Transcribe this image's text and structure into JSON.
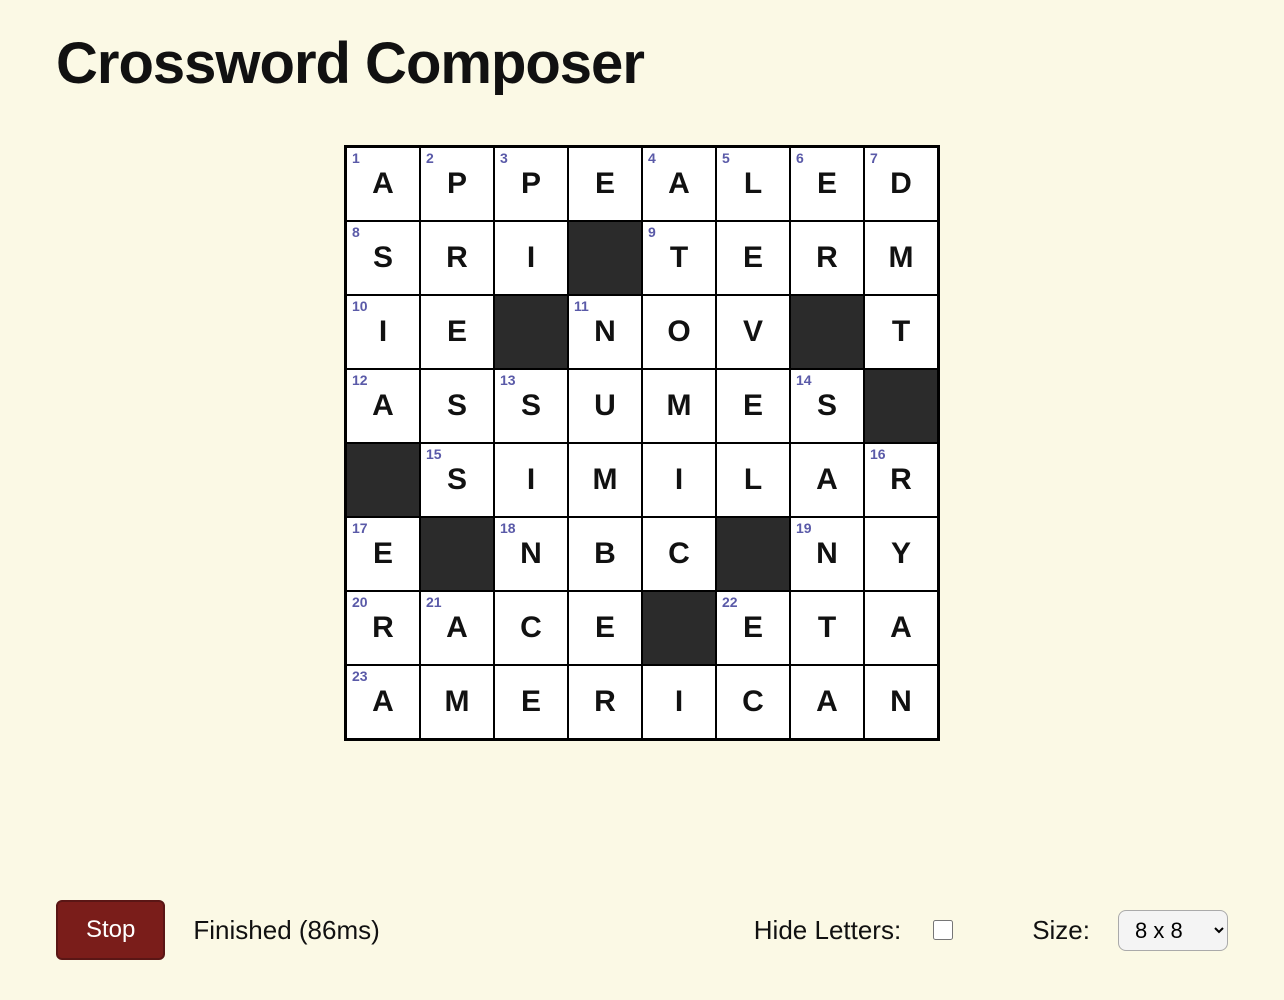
{
  "title": "Crossword Composer",
  "grid": {
    "size": 8,
    "rows": [
      [
        {
          "n": 1,
          "l": "A"
        },
        {
          "n": 2,
          "l": "P"
        },
        {
          "n": 3,
          "l": "P"
        },
        {
          "l": "E"
        },
        {
          "n": 4,
          "l": "A"
        },
        {
          "n": 5,
          "l": "L"
        },
        {
          "n": 6,
          "l": "E"
        },
        {
          "n": 7,
          "l": "D"
        }
      ],
      [
        {
          "n": 8,
          "l": "S"
        },
        {
          "l": "R"
        },
        {
          "l": "I"
        },
        {
          "black": true
        },
        {
          "n": 9,
          "l": "T"
        },
        {
          "l": "E"
        },
        {
          "l": "R"
        },
        {
          "l": "M"
        }
      ],
      [
        {
          "n": 10,
          "l": "I"
        },
        {
          "l": "E"
        },
        {
          "black": true
        },
        {
          "n": 11,
          "l": "N"
        },
        {
          "l": "O"
        },
        {
          "l": "V"
        },
        {
          "black": true
        },
        {
          "l": "T"
        }
      ],
      [
        {
          "n": 12,
          "l": "A"
        },
        {
          "l": "S"
        },
        {
          "n": 13,
          "l": "S"
        },
        {
          "l": "U"
        },
        {
          "l": "M"
        },
        {
          "l": "E"
        },
        {
          "n": 14,
          "l": "S"
        },
        {
          "black": true
        }
      ],
      [
        {
          "black": true
        },
        {
          "n": 15,
          "l": "S"
        },
        {
          "l": "I"
        },
        {
          "l": "M"
        },
        {
          "l": "I"
        },
        {
          "l": "L"
        },
        {
          "l": "A"
        },
        {
          "n": 16,
          "l": "R"
        }
      ],
      [
        {
          "n": 17,
          "l": "E"
        },
        {
          "black": true
        },
        {
          "n": 18,
          "l": "N"
        },
        {
          "l": "B"
        },
        {
          "l": "C"
        },
        {
          "black": true
        },
        {
          "n": 19,
          "l": "N"
        },
        {
          "l": "Y"
        }
      ],
      [
        {
          "n": 20,
          "l": "R"
        },
        {
          "n": 21,
          "l": "A"
        },
        {
          "l": "C"
        },
        {
          "l": "E"
        },
        {
          "black": true
        },
        {
          "n": 22,
          "l": "E"
        },
        {
          "l": "T"
        },
        {
          "l": "A"
        }
      ],
      [
        {
          "n": 23,
          "l": "A"
        },
        {
          "l": "M"
        },
        {
          "l": "E"
        },
        {
          "l": "R"
        },
        {
          "l": "I"
        },
        {
          "l": "C"
        },
        {
          "l": "A"
        },
        {
          "l": "N"
        }
      ]
    ]
  },
  "controls": {
    "stop_label": "Stop",
    "status_text": "Finished (86ms)",
    "hide_letters_label": "Hide Letters:",
    "hide_letters_checked": false,
    "size_label": "Size:",
    "size_value": "8 x 8"
  }
}
